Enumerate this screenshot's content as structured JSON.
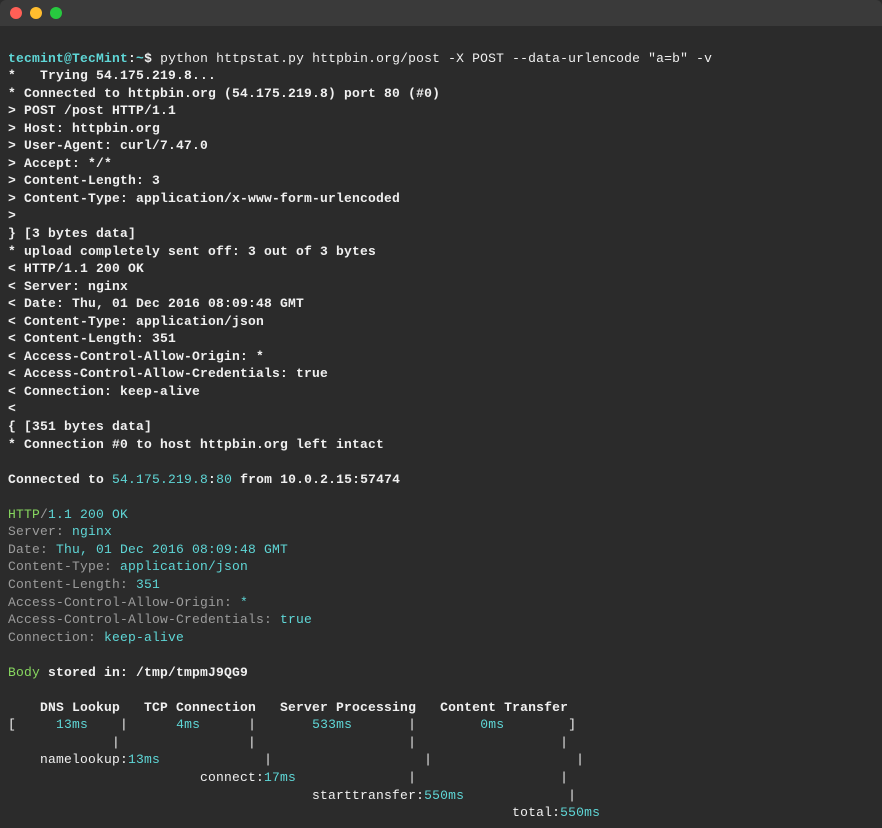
{
  "titlebar": {
    "close": "close",
    "minimize": "minimize",
    "maximize": "maximize"
  },
  "prompt": {
    "user": "tecmint@TecMint",
    "sep": ":",
    "path": "~",
    "sym": "$ ",
    "cmd": "python httpstat.py httpbin.org/post -X POST --data-urlencode \"a=b\" -v"
  },
  "curl": {
    "l1": "*   Trying 54.175.219.8...",
    "l2": "* Connected to httpbin.org (54.175.219.8) port 80 (#0)",
    "l3": "> POST /post HTTP/1.1",
    "l4": "> Host: httpbin.org",
    "l5": "> User-Agent: curl/7.47.0",
    "l6": "> Accept: */*",
    "l7": "> Content-Length: 3",
    "l8": "> Content-Type: application/x-www-form-urlencoded",
    "l9": "> ",
    "l10": "} [3 bytes data]",
    "l11": "* upload completely sent off: 3 out of 3 bytes",
    "l12": "< HTTP/1.1 200 OK",
    "l13": "< Server: nginx",
    "l14": "< Date: Thu, 01 Dec 2016 08:09:48 GMT",
    "l15": "< Content-Type: application/json",
    "l16": "< Content-Length: 351",
    "l17": "< Access-Control-Allow-Origin: *",
    "l18": "< Access-Control-Allow-Credentials: true",
    "l19": "< Connection: keep-alive",
    "l20": "< ",
    "l21": "{ [351 bytes data]",
    "l22": "* Connection #0 to host httpbin.org left intact"
  },
  "conn": {
    "pre": "Connected to ",
    "ip": "54.175.219.8",
    "colon": ":",
    "port": "80",
    "from": " from 10.0.2.15:57474"
  },
  "resp": {
    "http": "HTTP",
    "slash": "/",
    "status": "1.1 200 OK",
    "srv_k": "Server: ",
    "srv_v": "nginx",
    "date_k": "Date: ",
    "date_v": "Thu, 01 Dec 2016 08:09:48 GMT",
    "ct_k": "Content-Type: ",
    "ct_v": "application/json",
    "cl_k": "Content-Length: ",
    "cl_v": "351",
    "acao_k": "Access-Control-Allow-Origin: ",
    "acao_v": "*",
    "acac_k": "Access-Control-Allow-Credentials: ",
    "acac_v": "true",
    "cn_k": "Connection: ",
    "cn_v": "keep-alive"
  },
  "body": {
    "label": "Body",
    "stored": " stored in: /tmp/tmpmJ9QG9"
  },
  "timing": {
    "hdr": "    DNS Lookup   TCP Connection   Server Processing   Content Transfer",
    "row_open": "[",
    "dns": "     13ms    ",
    "pipe": "|",
    "tcp_pad": "      ",
    "tcp": "4ms",
    "tcp_post": "      ",
    "srv_pad": "       ",
    "srv": "533ms",
    "srv_post": "       ",
    "ct_pad": "        ",
    "ct": "0ms",
    "ct_post": "        ",
    "row_close": "]",
    "bars": "             |                |                   |                  |",
    "nl_pad": "    namelookup:",
    "nl_v": "13ms",
    "cn_bars": "             |                   |                  |",
    "cn_pad": "                        connect:",
    "cn_v": "17ms",
    "st_bars": "              |                  |",
    "st_pad": "                                      starttransfer:",
    "st_v": "550ms",
    "tt_bars": "             |",
    "tt_pad": "                                                               total:",
    "tt_v": "550ms"
  }
}
